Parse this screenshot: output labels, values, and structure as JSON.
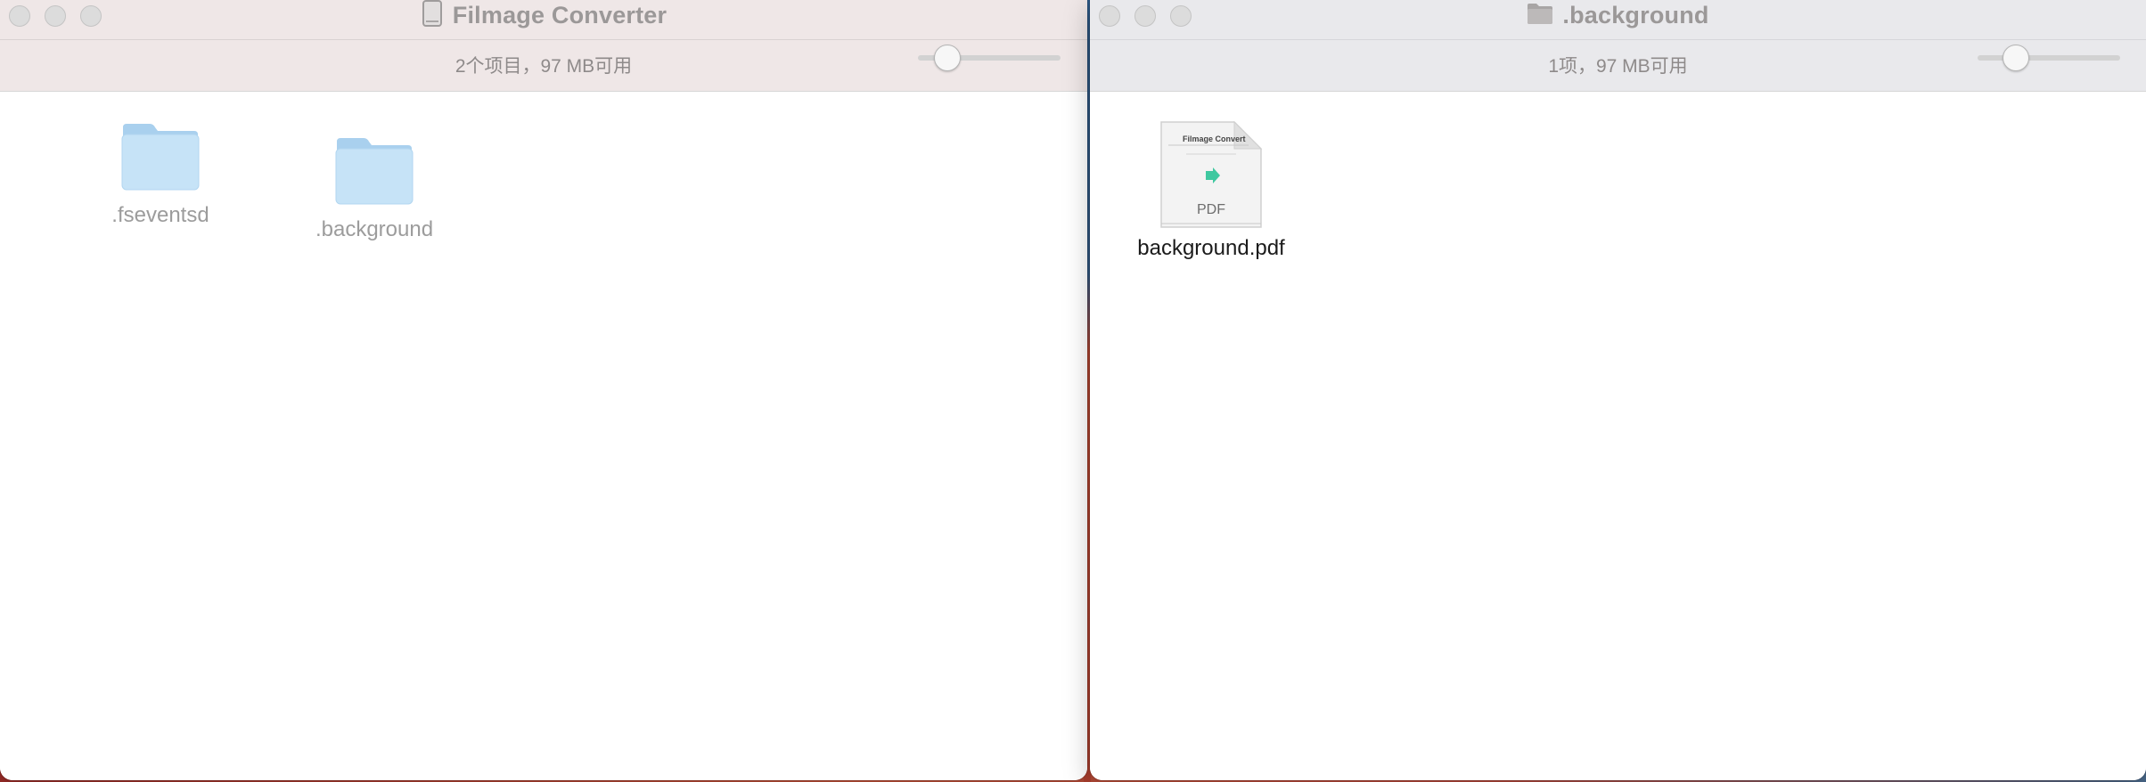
{
  "left_window": {
    "title": "Filmage Converter",
    "title_icon": "drive-icon",
    "status": "2个项目，97 MB可用",
    "icon_size_level": 0.2,
    "items": [
      {
        "name": ".fseventsd",
        "icon": "folder-icon"
      },
      {
        "name": ".background",
        "icon": "folder-icon"
      }
    ]
  },
  "right_window": {
    "title": ".background",
    "title_icon": "folder-icon",
    "status": "1项，97 MB可用",
    "icon_size_level": 0.25,
    "items": [
      {
        "name": "background.pdf",
        "icon": "pdf-document-icon",
        "badge": "PDF",
        "thumb_title": "Filmage Convert"
      }
    ]
  },
  "colors": {
    "folder_body": "#c6e3f7",
    "folder_tab": "#a9d0ee",
    "titlebar_left": "#efe7e7",
    "titlebar_right": "#e9e9ec",
    "accent_green": "#3fc8a0"
  }
}
